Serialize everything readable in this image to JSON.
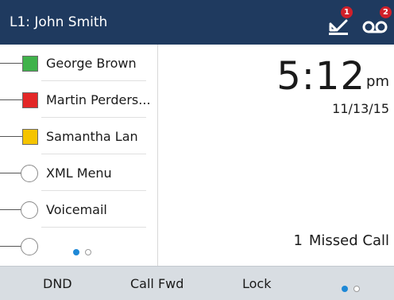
{
  "header": {
    "title": "L1: John Smith",
    "missed_badge": "1",
    "voicemail_badge": "2",
    "background": "#1f3a5f",
    "badge_color": "#d0202a"
  },
  "lines": [
    {
      "label": "George Brown",
      "status": "green",
      "color": "#3fb24a"
    },
    {
      "label": "Martin Perders...",
      "status": "red",
      "color": "#e32727"
    },
    {
      "label": "Samantha Lan",
      "status": "yellow",
      "color": "#f5c400"
    },
    {
      "label": "XML Menu",
      "status": "none"
    },
    {
      "label": "Voicemail",
      "status": "none"
    },
    {
      "label": "",
      "status": "none"
    }
  ],
  "clock": {
    "time": "5:12",
    "ampm": "pm",
    "date": "11/13/15"
  },
  "missed_calls": {
    "count": "1",
    "label": "Missed Call"
  },
  "softkeys": {
    "dnd": "DND",
    "call_fwd": "Call Fwd",
    "lock": "Lock"
  },
  "pagination": {
    "current_page": 1,
    "total_pages": 2,
    "active_color": "#1e88d6"
  }
}
